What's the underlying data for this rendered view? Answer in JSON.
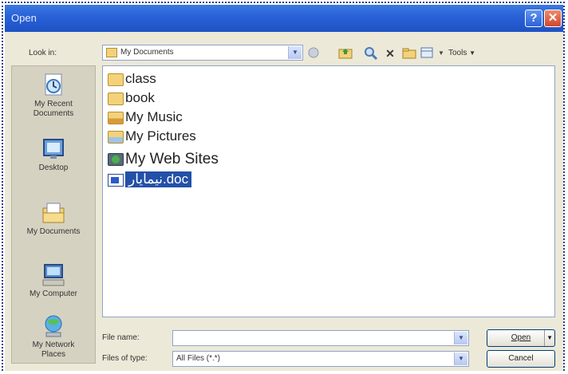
{
  "window": {
    "title": "Open",
    "help": "?",
    "close": "✕"
  },
  "toolbar": {
    "look_in_label": "Look in:",
    "look_in_value": "My Documents",
    "tools_label": "Tools"
  },
  "places": [
    {
      "label_1": "My Recent",
      "label_2": "Documents",
      "icon": "recent-documents-icon"
    },
    {
      "label_1": "Desktop",
      "label_2": "",
      "icon": "desktop-icon"
    },
    {
      "label_1": "My Documents",
      "label_2": "",
      "icon": "my-documents-icon"
    },
    {
      "label_1": "My Computer",
      "label_2": "",
      "icon": "my-computer-icon"
    },
    {
      "label_1": "My Network",
      "label_2": "Places",
      "icon": "network-places-icon"
    }
  ],
  "files": [
    {
      "name": "class",
      "icon": "folder-icon"
    },
    {
      "name": "book",
      "icon": "folder-icon"
    },
    {
      "name": "My Music",
      "icon": "music-folder-icon"
    },
    {
      "name": "My Pictures",
      "icon": "pictures-folder-icon"
    },
    {
      "name": "My Web Sites",
      "icon": "web-folder-icon"
    },
    {
      "name": "نیمایار.doc",
      "icon": "doc-file-icon"
    }
  ],
  "footer": {
    "file_name_label": "File name:",
    "file_name_value": "",
    "file_type_label": "Files of type:",
    "file_type_value": "All Files (*.*)",
    "open_label": "Open",
    "cancel_label": "Cancel"
  }
}
